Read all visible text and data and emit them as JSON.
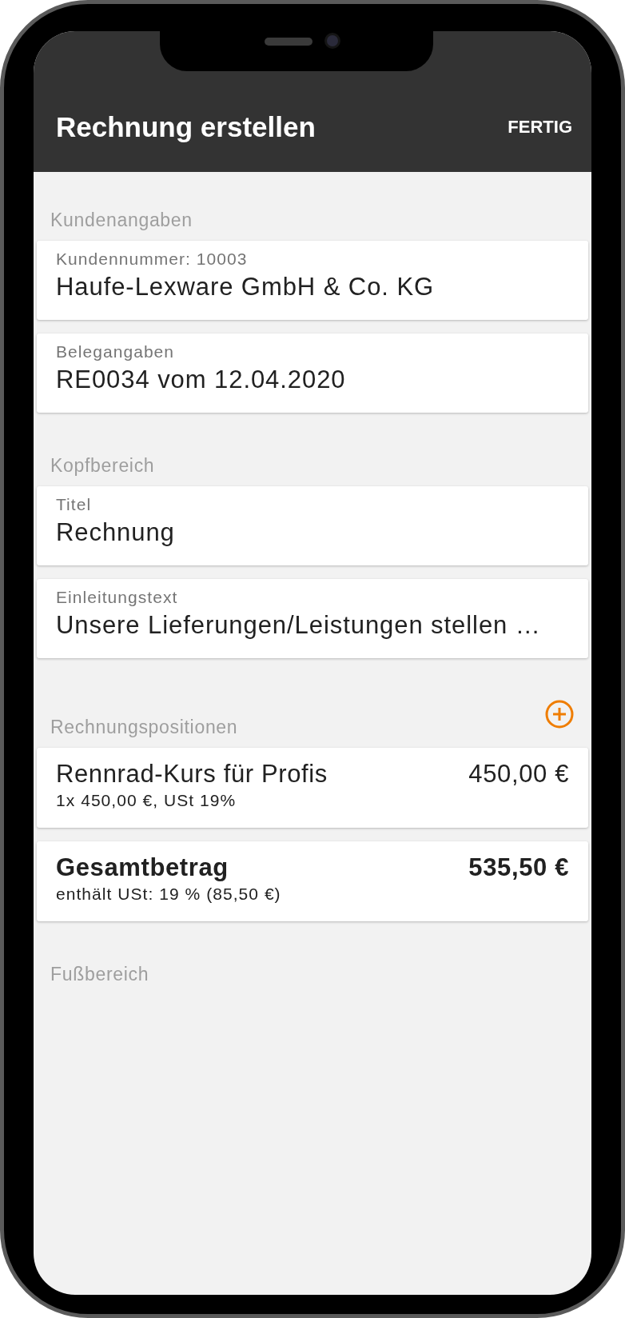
{
  "header": {
    "title": "Rechnung erstellen",
    "action": "FERTIG"
  },
  "sections": [
    {
      "heading": "Kundenangaben",
      "add_button": false,
      "cards": [
        {
          "kind": "field",
          "label": "Kundennummer: 10003",
          "value": "Haufe-Lexware GmbH & Co. KG"
        },
        {
          "kind": "field",
          "label": "Belegangaben",
          "value": "RE0034 vom 12.04.2020"
        }
      ]
    },
    {
      "heading": "Kopfbereich",
      "add_button": false,
      "cards": [
        {
          "kind": "field",
          "label": "Titel",
          "value": "Rechnung"
        },
        {
          "kind": "field",
          "label": "Einleitungstext",
          "value": "Unsere Lieferungen/Leistungen stellen …"
        }
      ]
    },
    {
      "heading": "Rechnungspositionen",
      "add_button": true,
      "cards": [
        {
          "kind": "item",
          "name": "Rennrad-Kurs für Profis",
          "amount": "450,00 €",
          "detail": "1x 450,00 €, USt 19%"
        },
        {
          "kind": "total",
          "name": "Gesamtbetrag",
          "amount": "535,50 €",
          "detail": "enthält USt: 19 % (85,50 €)"
        }
      ]
    },
    {
      "heading": "Fußbereich",
      "add_button": false
    }
  ]
}
